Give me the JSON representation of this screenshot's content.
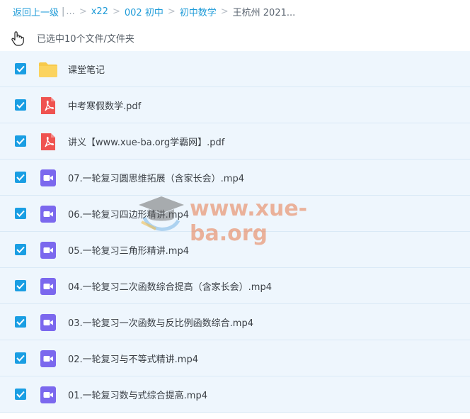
{
  "breadcrumb": {
    "back": "返回上一级",
    "ellipsis": "...",
    "items": [
      "x22",
      "002 初中",
      "初中数学"
    ],
    "current": "王杭州 2021..."
  },
  "selection": {
    "text": "已选中10个文件/文件夹"
  },
  "files": [
    {
      "name": "课堂笔记",
      "type": "folder"
    },
    {
      "name": "中考寒假数学.pdf",
      "type": "pdf"
    },
    {
      "name": "讲义【www.xue-ba.org学霸网】.pdf",
      "type": "pdf"
    },
    {
      "name": "07.一轮复习圆思维拓展（含家长会）.mp4",
      "type": "video"
    },
    {
      "name": "06.一轮复习四边形精讲.mp4",
      "type": "video"
    },
    {
      "name": "05.一轮复习三角形精讲.mp4",
      "type": "video"
    },
    {
      "name": "04.一轮复习二次函数综合提高（含家长会）.mp4",
      "type": "video"
    },
    {
      "name": "03.一轮复习一次函数与反比例函数综合.mp4",
      "type": "video"
    },
    {
      "name": "02.一轮复习与不等式精讲.mp4",
      "type": "video"
    },
    {
      "name": "01.一轮复习数与式综合提高.mp4",
      "type": "video"
    }
  ],
  "watermark": {
    "text": "www.xue-ba.org"
  },
  "colors": {
    "link": "#1e9bd8",
    "checkbox": "#1a9ee3",
    "row_bg": "#eef6fd",
    "folder": "#f7c94b",
    "pdf": "#ef5350",
    "video": "#7b68ee"
  }
}
